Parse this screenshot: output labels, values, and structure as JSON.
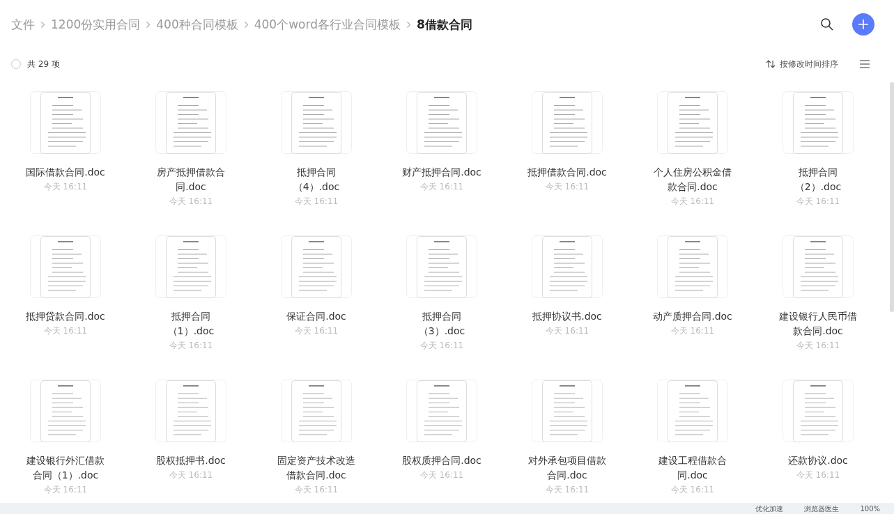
{
  "breadcrumb": [
    {
      "label": "文件",
      "current": false
    },
    {
      "label": "1200份实用合同",
      "current": false
    },
    {
      "label": "400种合同模板",
      "current": false
    },
    {
      "label": "400个word各行业合同模板",
      "current": false
    },
    {
      "label": "8借款合同",
      "current": true
    }
  ],
  "toolbar": {
    "select_all": {
      "checked": false,
      "label": "共 29 项"
    },
    "sort": "按修改时间排序"
  },
  "files": [
    {
      "name": "国际借款合同.doc",
      "time": "今天 16:11"
    },
    {
      "name": "房产抵押借款合同.doc",
      "time": "今天 16:11"
    },
    {
      "name": "抵押合同（4）.doc",
      "time": "今天 16:11"
    },
    {
      "name": "财产抵押合同.doc",
      "time": "今天 16:11"
    },
    {
      "name": "抵押借款合同.doc",
      "time": "今天 16:11"
    },
    {
      "name": "个人住房公积金借款合同.doc",
      "time": "今天 16:11"
    },
    {
      "name": "抵押合同（2）.doc",
      "time": "今天 16:11"
    },
    {
      "name": "抵押贷款合同.doc",
      "time": "今天 16:11"
    },
    {
      "name": "抵押合同（1）.doc",
      "time": "今天 16:11"
    },
    {
      "name": "保证合同.doc",
      "time": "今天 16:11"
    },
    {
      "name": "抵押合同（3）.doc",
      "time": "今天 16:11"
    },
    {
      "name": "抵押协议书.doc",
      "time": "今天 16:11"
    },
    {
      "name": "动产质押合同.doc",
      "time": "今天 16:11"
    },
    {
      "name": "建设银行人民币借款合同.doc",
      "time": "今天 16:11"
    },
    {
      "name": "建设银行外汇借款合同（1）.doc",
      "time": "今天 16:11"
    },
    {
      "name": "股权抵押书.doc",
      "time": "今天 16:11"
    },
    {
      "name": "固定资产技术改造借款合同.doc",
      "time": "今天 16:11"
    },
    {
      "name": "股权质押合同.doc",
      "time": "今天 16:11"
    },
    {
      "name": "对外承包项目借款合同.doc",
      "time": "今天 16:11"
    },
    {
      "name": "建设工程借款合同.doc",
      "time": "今天 16:11"
    },
    {
      "name": "还款协议.doc",
      "time": "今天 16:11"
    }
  ],
  "status_bar": [
    "优化加速",
    "浏览器医生",
    "100%"
  ]
}
